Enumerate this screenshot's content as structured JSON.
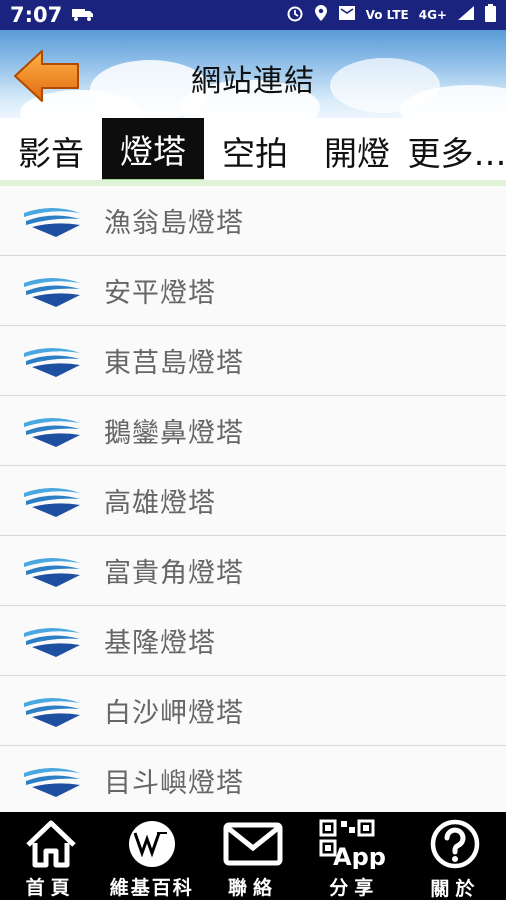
{
  "status_bar": {
    "time": "7:07",
    "network_label": "4G+",
    "volte_label": "Vo LTE"
  },
  "header": {
    "title": "網站連結"
  },
  "tabs": [
    {
      "label": "影音",
      "active": false
    },
    {
      "label": "燈塔",
      "active": true
    },
    {
      "label": "空拍",
      "active": false
    },
    {
      "label": "開燈",
      "active": false
    },
    {
      "label": "更多…",
      "active": false
    }
  ],
  "list": {
    "items": [
      {
        "label": "漁翁島燈塔"
      },
      {
        "label": "安平燈塔"
      },
      {
        "label": "東莒島燈塔"
      },
      {
        "label": "鵝鑾鼻燈塔"
      },
      {
        "label": "高雄燈塔"
      },
      {
        "label": "富貴角燈塔"
      },
      {
        "label": "基隆燈塔"
      },
      {
        "label": "白沙岬燈塔"
      },
      {
        "label": "目斗嶼燈塔"
      }
    ]
  },
  "bottom_nav": {
    "items": [
      {
        "label": "首頁",
        "icon": "home-icon"
      },
      {
        "label": "維基百科",
        "icon": "wikipedia-icon"
      },
      {
        "label": "聯絡",
        "icon": "mail-icon"
      },
      {
        "label": "分享",
        "icon": "qr-app-icon"
      },
      {
        "label": "關於",
        "icon": "help-icon"
      }
    ],
    "qr_text": "App"
  },
  "colors": {
    "status_bar": "#1a237e",
    "active_tab": "#0d0d0d",
    "tab_accent": "#9fd88a",
    "back_arrow": "#f08a24",
    "logo_blue": "#1f4fa0",
    "logo_light": "#4aa8e0"
  }
}
